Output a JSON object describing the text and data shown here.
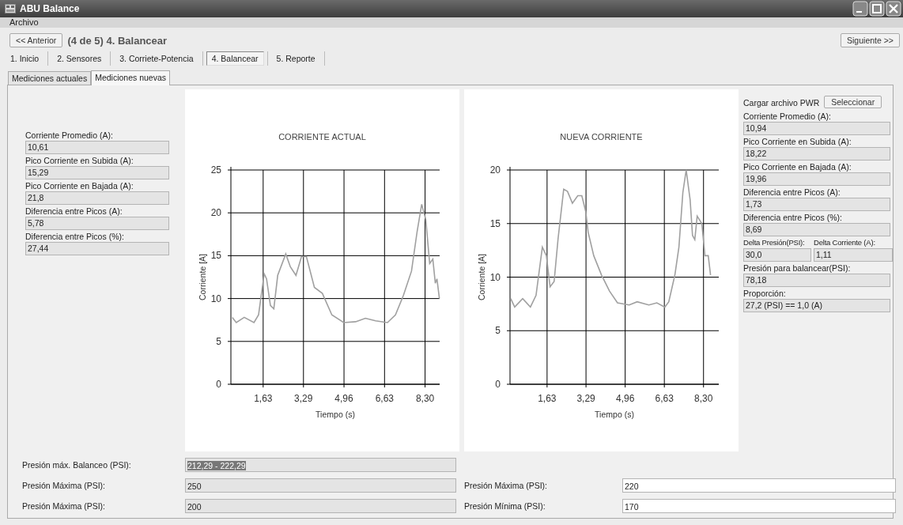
{
  "window": {
    "title": "ABU Balance"
  },
  "menu": [
    {
      "label": "Archivo"
    }
  ],
  "nav": {
    "prev": "<< Anterior",
    "heading": "(4 de 5) 4. Balancear",
    "next": "Siguiente >>"
  },
  "steps": [
    {
      "label": "1. Inicio",
      "selected": false
    },
    {
      "label": "2. Sensores",
      "selected": false
    },
    {
      "label": "3. Corriete-Potencia",
      "selected": false
    },
    {
      "label": "4. Balancear",
      "selected": true
    },
    {
      "label": "5. Reporte",
      "selected": false
    }
  ],
  "tabs": [
    {
      "label": "Mediciones actuales",
      "selected": false
    },
    {
      "label": "Mediciones nuevas",
      "selected": true
    }
  ],
  "left_fields": [
    {
      "label": "Corriente Promedio (A):",
      "value": "10,61"
    },
    {
      "label": "Pico Corriente en Subida (A):",
      "value": "15,29"
    },
    {
      "label": "Pico Corriente en Bajada (A):",
      "value": "21,8"
    },
    {
      "label": "Diferencia entre Picos (A):",
      "value": "5,78"
    },
    {
      "label": "Diferencia entre Picos (%):",
      "value": "27,44"
    }
  ],
  "charts": [
    {
      "chart_data": {
        "type": "line",
        "title": "CORRIENTE ACTUAL",
        "xlabel": "Tiempo (s)",
        "ylabel": "Corriente [A]",
        "xlim": [
          0.3,
          8.9
        ],
        "ylim": [
          0,
          25
        ],
        "xticks": [
          {
            "value": 1.63,
            "label": "1,63"
          },
          {
            "value": 3.29,
            "label": "3,29"
          },
          {
            "value": 4.96,
            "label": "4,96"
          },
          {
            "value": 6.63,
            "label": "6,63"
          },
          {
            "value": 8.3,
            "label": "8,30"
          }
        ],
        "yticks": [
          0,
          5,
          10,
          15,
          20,
          25
        ],
        "x": [
          0.36,
          0.52,
          0.85,
          1.25,
          1.44,
          1.67,
          1.77,
          1.93,
          2.07,
          2.23,
          2.56,
          2.75,
          2.98,
          3.21,
          3.41,
          3.74,
          4.07,
          4.46,
          4.95,
          5.44,
          5.84,
          6.26,
          6.75,
          7.08,
          7.41,
          7.74,
          7.97,
          8.16,
          8.33,
          8.49,
          8.62,
          8.72,
          8.79,
          8.89
        ],
        "grid": true,
        "series": [
          {
            "color": "#a0a0a0",
            "values": [
              7.8,
              7.2,
              7.8,
              7.2,
              8.1,
              12.9,
              12.3,
              9.2,
              8.8,
              12.7,
              15.2,
              13.7,
              12.7,
              14.9,
              14.9,
              11.3,
              10.6,
              8.1,
              7.2,
              7.3,
              7.7,
              7.4,
              7.2,
              8.1,
              10.4,
              13.2,
              17.8,
              21.0,
              19.2,
              14.1,
              14.6,
              11.8,
              12.3,
              10.0
            ]
          }
        ]
      }
    },
    {
      "chart_data": {
        "type": "line",
        "title": "NUEVA CORRIENTE",
        "xlabel": "Tiempo (s)",
        "ylabel": "Corriente [A]",
        "xlim": [
          0.05,
          8.95
        ],
        "ylim": [
          0,
          20
        ],
        "xticks": [
          {
            "value": 1.63,
            "label": "1,63"
          },
          {
            "value": 3.29,
            "label": "3,29"
          },
          {
            "value": 4.96,
            "label": "4,96"
          },
          {
            "value": 6.63,
            "label": "6,63"
          },
          {
            "value": 8.3,
            "label": "8,30"
          }
        ],
        "yticks": [
          0,
          5,
          10,
          15,
          20
        ],
        "x": [
          0.08,
          0.25,
          0.59,
          0.92,
          1.16,
          1.43,
          1.6,
          1.76,
          1.93,
          2.1,
          2.34,
          2.5,
          2.71,
          2.94,
          3.11,
          3.28,
          3.38,
          3.62,
          3.95,
          4.29,
          4.63,
          5.13,
          5.47,
          5.97,
          6.31,
          6.65,
          6.82,
          7.08,
          7.25,
          7.42,
          7.56,
          7.73,
          7.83,
          7.93,
          8.03,
          8.23,
          8.36,
          8.5,
          8.6
        ],
        "grid": true,
        "series": [
          {
            "color": "#a0a0a0",
            "values": [
              8.0,
              7.2,
              8.0,
              7.2,
              8.3,
              12.8,
              12.0,
              9.1,
              9.6,
              13.6,
              18.2,
              18.0,
              16.9,
              17.6,
              17.6,
              16.1,
              14.2,
              12.0,
              10.2,
              8.7,
              7.6,
              7.4,
              7.7,
              7.4,
              7.6,
              7.2,
              7.7,
              10.2,
              12.8,
              17.9,
              20.0,
              17.2,
              13.9,
              13.5,
              15.7,
              15.0,
              12.0,
              12.0,
              10.2
            ]
          }
        ]
      }
    }
  ],
  "right_panel": {
    "load_label": "Cargar archivo PWR",
    "select_button": "Seleccionar",
    "fields": [
      {
        "kind": "single",
        "label": "Corriente Promedio (A):",
        "value": "10,94"
      },
      {
        "kind": "single",
        "label": "Pico Corriente en Subida (A):",
        "value": "18,22"
      },
      {
        "kind": "single",
        "label": "Pico Corriente en Bajada (A):",
        "value": "19,96"
      },
      {
        "kind": "single",
        "label": "Diferencia entre Picos (A):",
        "value": "1,73"
      },
      {
        "kind": "single",
        "label": "Diferencia entre Picos (%):",
        "value": "8,69"
      },
      {
        "kind": "pair",
        "label": "Delta Presión(PSI):",
        "value": "30,0",
        "label_2": "Delta Corriente (A):",
        "value_2": "1,11"
      },
      {
        "kind": "single",
        "label": "Presión para balancear(PSI):",
        "value": "78,18"
      },
      {
        "kind": "single",
        "label": "Proporción:",
        "value": "27,2 (PSI) == 1,0 (A)"
      }
    ]
  },
  "bottom_rows": [
    {
      "left": {
        "label": "Presión máx. Balanceo (PSI):",
        "value": "212,29 - 222,29",
        "editable": false,
        "text_selected": true
      }
    },
    {
      "left": {
        "label": "Presión Máxima (PSI):",
        "value": "250",
        "editable": false,
        "text_selected": false
      },
      "right": {
        "label": "Presión Máxima (PSI):",
        "value": "220",
        "editable": true,
        "text_selected": false
      }
    },
    {
      "left": {
        "label": "Presión Máxima (PSI):",
        "value": "200",
        "editable": false,
        "text_selected": false
      },
      "right": {
        "label": "Presión Mínima (PSI):",
        "value": "170",
        "editable": true,
        "text_selected": false
      }
    }
  ]
}
